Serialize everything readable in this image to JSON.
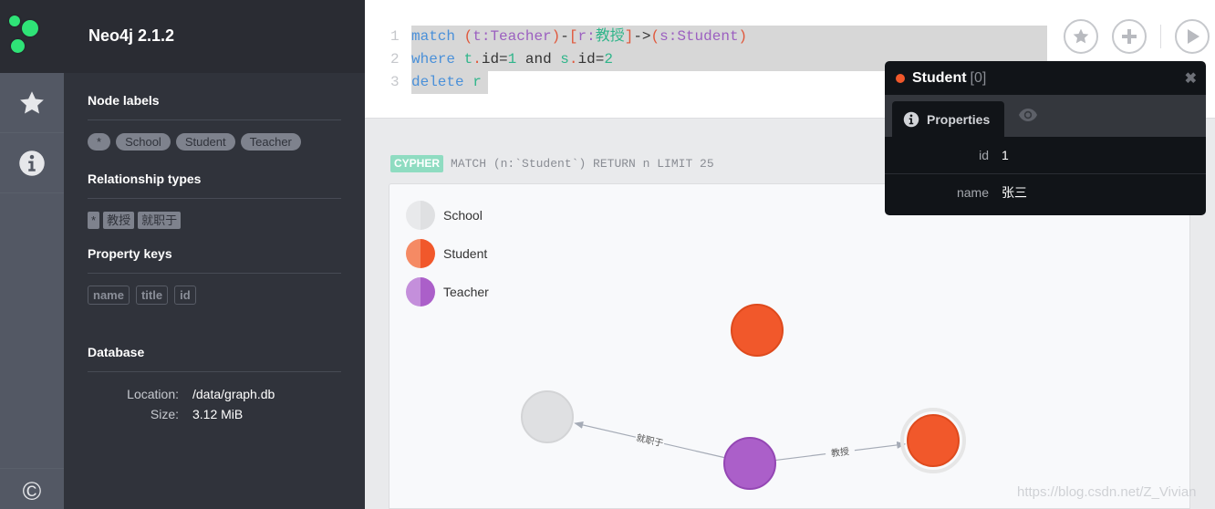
{
  "app": {
    "title": "Neo4j 2.1.2"
  },
  "iconbar": {
    "items": [
      {
        "name": "favorites",
        "icon": "star-icon"
      },
      {
        "name": "info",
        "icon": "info-icon"
      }
    ],
    "bottom_icon": "©"
  },
  "drawer": {
    "node_labels": {
      "title": "Node labels",
      "items": [
        "*",
        "School",
        "Student",
        "Teacher"
      ]
    },
    "relationship_types": {
      "title": "Relationship types",
      "items": [
        "*",
        "教授",
        "就职于"
      ]
    },
    "property_keys": {
      "title": "Property keys",
      "items": [
        "name",
        "title",
        "id"
      ]
    },
    "database": {
      "title": "Database",
      "rows": [
        {
          "label": "Location:",
          "value": "/data/graph.db"
        },
        {
          "label": "Size:",
          "value": "3.12 MiB"
        }
      ]
    }
  },
  "editor": {
    "line_numbers": [
      "1",
      "2",
      "3"
    ],
    "lines": [
      [
        {
          "t": "match",
          "c": "k"
        },
        {
          "t": " ",
          "c": "d"
        },
        {
          "t": "(",
          "c": "p"
        },
        {
          "t": "t:Teacher",
          "c": "v"
        },
        {
          "t": ")",
          "c": "p"
        },
        {
          "t": "-",
          "c": "d"
        },
        {
          "t": "[",
          "c": "p"
        },
        {
          "t": "r:",
          "c": "v"
        },
        {
          "t": "教授",
          "c": "g"
        },
        {
          "t": "]",
          "c": "p"
        },
        {
          "t": "->",
          "c": "d"
        },
        {
          "t": "(",
          "c": "p"
        },
        {
          "t": "s:Student",
          "c": "v"
        },
        {
          "t": ")",
          "c": "p"
        }
      ],
      [
        {
          "t": "where",
          "c": "k"
        },
        {
          "t": " ",
          "c": "d"
        },
        {
          "t": "t",
          "c": "g"
        },
        {
          "t": ".",
          "c": "p"
        },
        {
          "t": "id=",
          "c": "d"
        },
        {
          "t": "1",
          "c": "g"
        },
        {
          "t": " and ",
          "c": "d"
        },
        {
          "t": "s",
          "c": "g"
        },
        {
          "t": ".",
          "c": "p"
        },
        {
          "t": "id=",
          "c": "d"
        },
        {
          "t": "2",
          "c": "g"
        }
      ],
      [
        {
          "t": "delete",
          "c": "k"
        },
        {
          "t": " ",
          "c": "d"
        },
        {
          "t": "r",
          "c": "g"
        }
      ]
    ],
    "buttons": [
      "favorite-button",
      "add-button",
      "run-button"
    ]
  },
  "frame": {
    "badge": "CYPHER",
    "query": "MATCH (n:`Student`) RETURN n LIMIT 25",
    "legend": [
      {
        "label": "School",
        "color_light": "#e8e9eb",
        "color": "#dfe0e2"
      },
      {
        "label": "Student",
        "color_light": "#f58a64",
        "color": "#f1582b"
      },
      {
        "label": "Teacher",
        "color_light": "#c48fdb",
        "color": "#ab5fc9"
      }
    ]
  },
  "graph": {
    "nodes": [
      {
        "id": "student-top",
        "label": "Student",
        "color": "#f1582b",
        "stroke": "#de4a1d"
      },
      {
        "id": "school",
        "label": "School",
        "color": "#dfe0e2",
        "stroke": "#d3d4d6"
      },
      {
        "id": "teacher",
        "label": "Teacher",
        "color": "#ab5fc9",
        "stroke": "#9447b4"
      },
      {
        "id": "student-selected",
        "label": "Student",
        "color": "#f1582b",
        "stroke": "#de4a1d",
        "selected": true
      }
    ],
    "relationships": [
      {
        "from": "teacher",
        "to": "school",
        "type": "就职于"
      },
      {
        "from": "teacher",
        "to": "student-selected",
        "type": "教授"
      }
    ]
  },
  "inspector": {
    "label": "Student",
    "id": "[0]",
    "dot_color": "#f1582b",
    "close": "✖",
    "tab": "Properties",
    "properties": [
      {
        "key": "id",
        "value": "1"
      },
      {
        "key": "name",
        "value": "张三"
      }
    ]
  },
  "watermark": "https://blog.csdn.net/Z_Vivian"
}
